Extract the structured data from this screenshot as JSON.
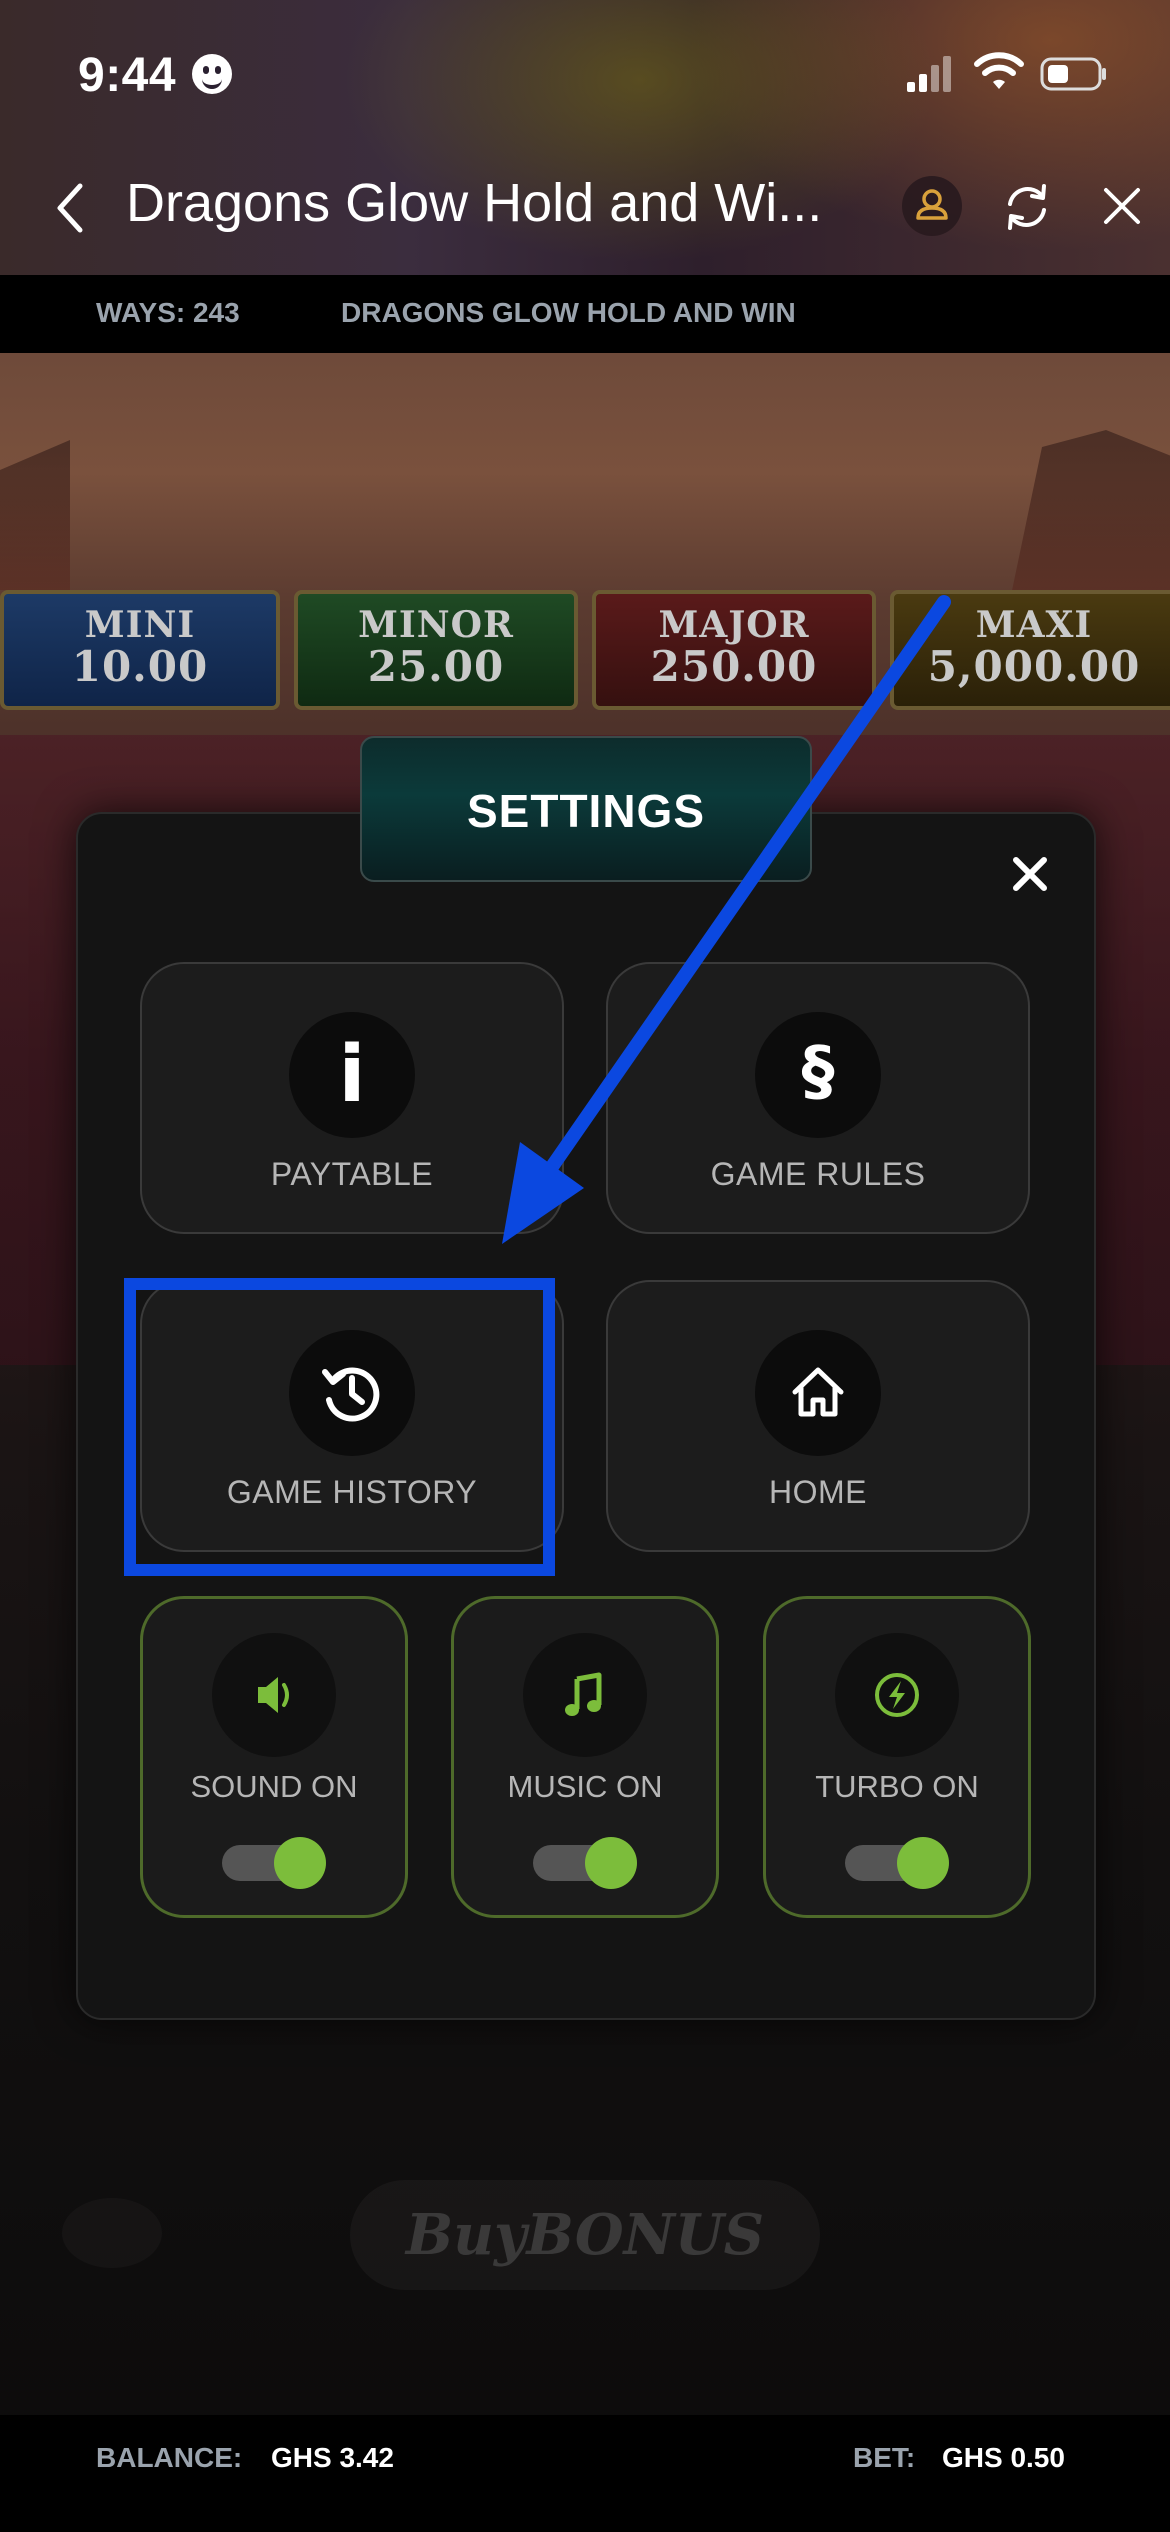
{
  "status_bar": {
    "time": "9:44"
  },
  "title_bar": {
    "title": "Dragons Glow Hold and Wi..."
  },
  "info_bar": {
    "ways": "WAYS: 243",
    "game_name": "DRAGONS GLOW HOLD AND WIN"
  },
  "jackpots": [
    {
      "name": "MINI",
      "value": "10.00"
    },
    {
      "name": "MINOR",
      "value": "25.00"
    },
    {
      "name": "MAJOR",
      "value": "250.00"
    },
    {
      "name": "MAXI",
      "value": "5,000.00"
    }
  ],
  "background": {
    "buy_bonus": "BuyBONUS"
  },
  "settings": {
    "title": "SETTINGS",
    "tiles": {
      "paytable": "PAYTABLE",
      "game_rules": "GAME RULES",
      "game_history": "GAME HISTORY",
      "home": "HOME"
    },
    "toggles": {
      "sound": {
        "label": "SOUND ON",
        "on": true
      },
      "music": {
        "label": "MUSIC ON",
        "on": true
      },
      "turbo": {
        "label": "TURBO ON",
        "on": true
      }
    },
    "icons": {
      "paytable": "info-icon",
      "game_rules": "section-sign-icon",
      "game_history": "history-icon",
      "home": "home-icon",
      "sound": "speaker-icon",
      "music": "music-note-icon",
      "turbo": "lightning-icon"
    },
    "accent_color": "#7cbd3b"
  },
  "annotation": {
    "color": "#0b48e0",
    "highlighted": "GAME HISTORY"
  },
  "bottom_bar": {
    "balance_label": "BALANCE:",
    "balance_value": "GHS 3.42",
    "bet_label": "BET:",
    "bet_value": "GHS 0.50"
  }
}
